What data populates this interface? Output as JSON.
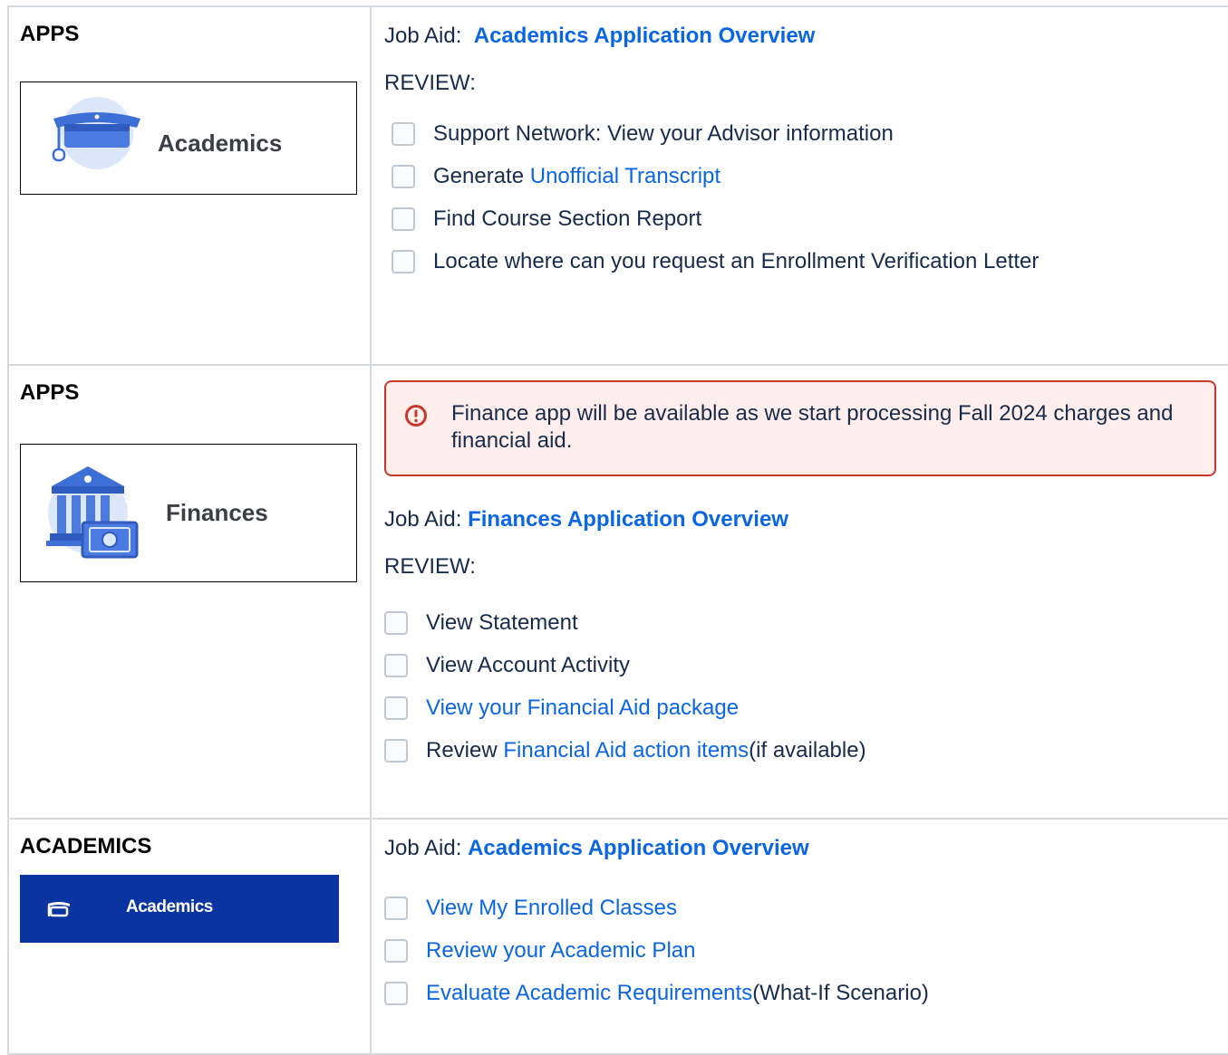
{
  "rows": [
    {
      "section_title": "APPS",
      "card_label": "Academics",
      "job_aid_prefix": "Job Aid:",
      "job_aid_link": "Academics Application Overview",
      "review_label": "REVIEW:",
      "tasks": [
        {
          "text": "Support Network: View your Advisor information"
        },
        {
          "text": "Generate ",
          "link": "Unofficial Transcript"
        },
        {
          "text": "Find Course Section Report"
        },
        {
          "text": "Locate where can you request an Enrollment Verification Letter"
        }
      ]
    },
    {
      "section_title": "APPS",
      "card_label": "Finances",
      "notice": "Finance app will be available as we start processing Fall 2024 charges and financial aid.",
      "job_aid_prefix": "Job Aid:",
      "job_aid_link": "Finances Application Overview",
      "review_label": "REVIEW:",
      "tasks": [
        {
          "text": "View Statement"
        },
        {
          "text": "View Account Activity"
        },
        {
          "link": "View your Financial Aid package"
        },
        {
          "text": "Review ",
          "link": "Financial Aid action items",
          "suffix": " (if available)"
        }
      ]
    },
    {
      "section_title": "ACADEMICS",
      "card_label": "Academics",
      "job_aid_prefix": "Job Aid:",
      "job_aid_link": "Academics Application Overview",
      "tasks": [
        {
          "link": "View My Enrolled Classes"
        },
        {
          "link": "Review your Academic Plan"
        },
        {
          "link": "Evaluate Academic Requirements",
          "suffix": " (What-If Scenario)"
        }
      ]
    }
  ],
  "colors": {
    "link": "#0b66e4",
    "banner": "#0a35a0",
    "notice_border": "#c9372c",
    "notice_bg": "#ffeeeb",
    "icon_blue": "#3d6fd6",
    "icon_circle": "#dde7fb"
  },
  "icons": [
    "graduation-cap-icon",
    "bank-building-icon",
    "cash-icon",
    "error-icon"
  ]
}
